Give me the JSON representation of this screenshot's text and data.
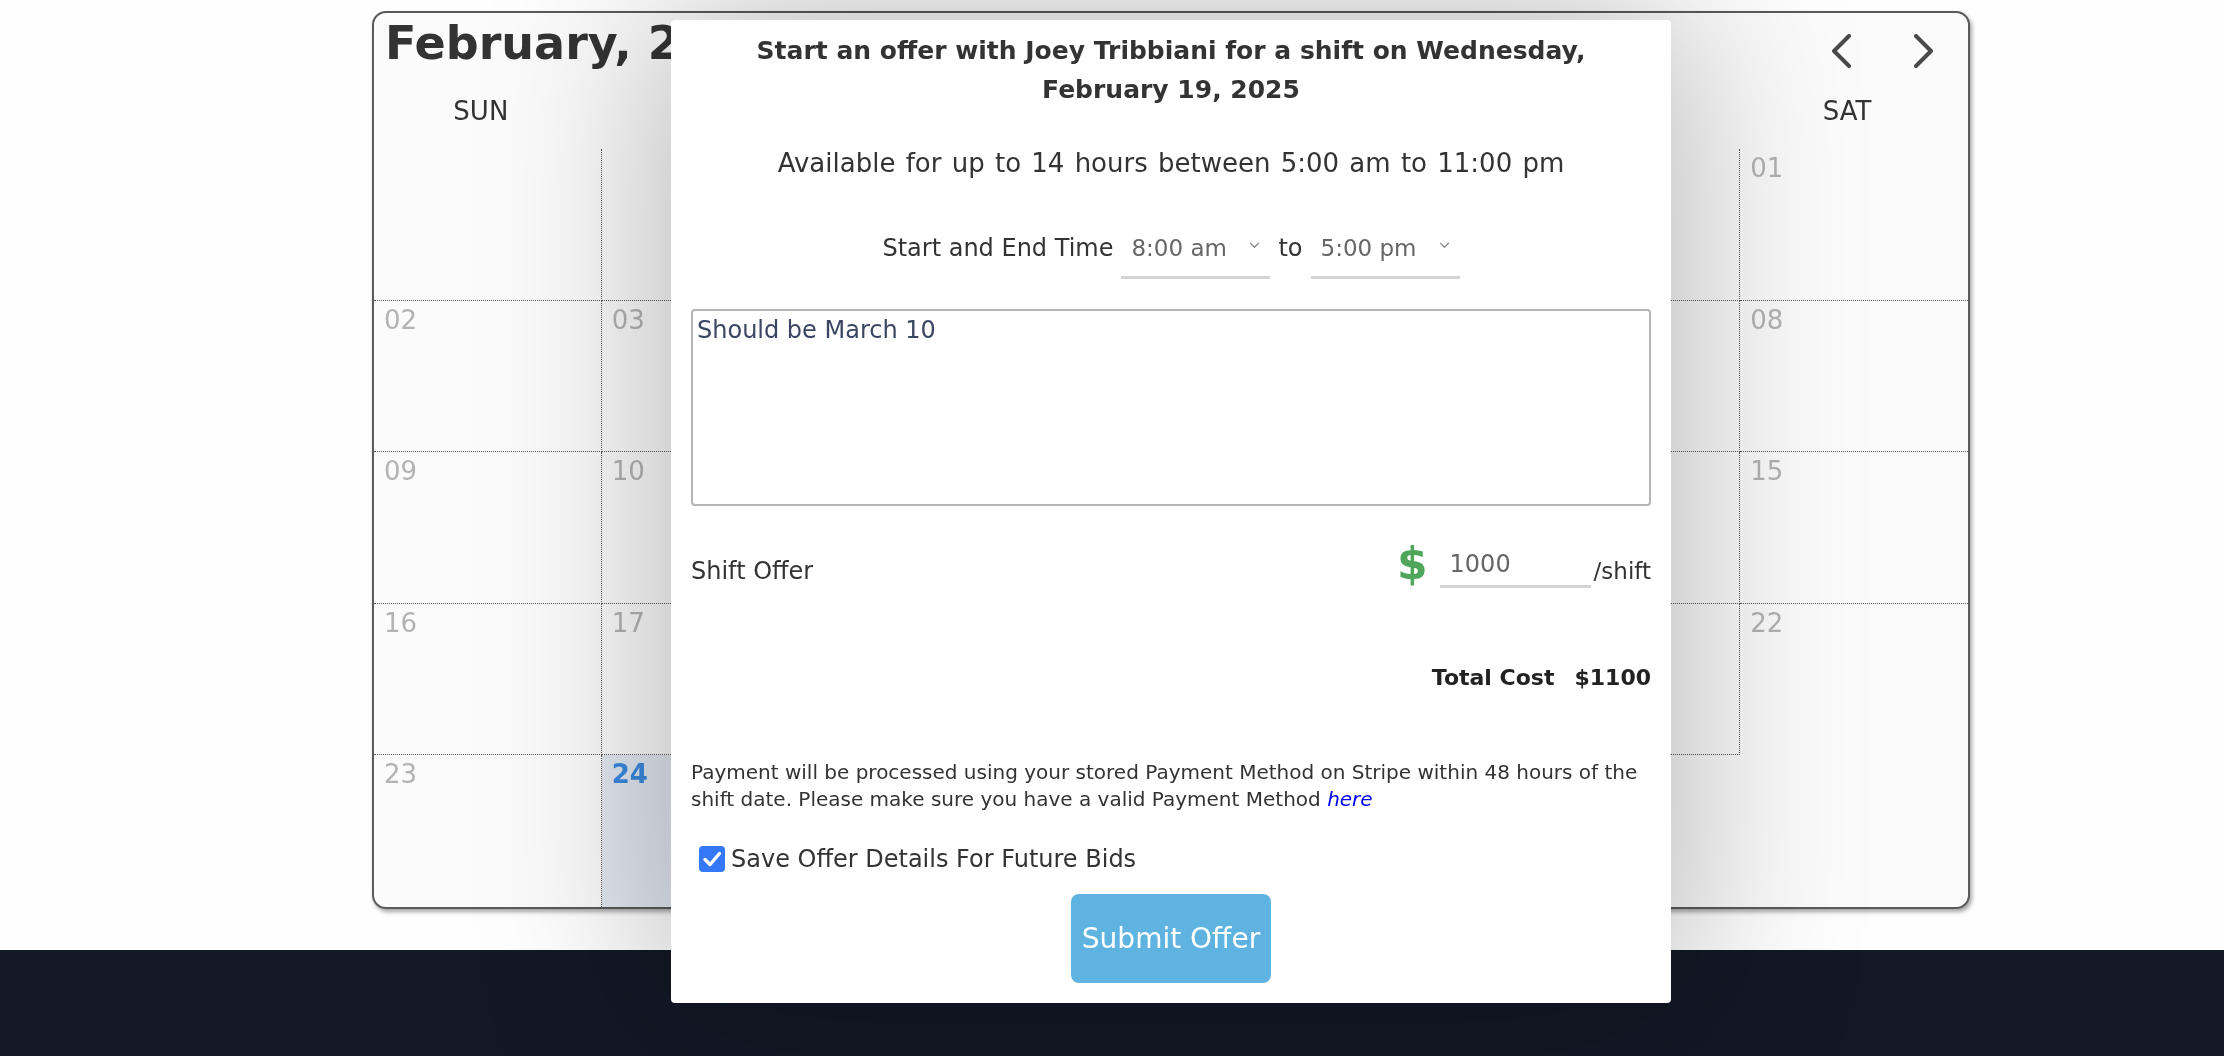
{
  "calendar": {
    "title": "February, 2",
    "weekdays": {
      "sun": "SUN",
      "sat": "SAT"
    },
    "weeks": [
      {
        "sat": {
          "day": "01",
          "today": false
        }
      },
      {
        "sun": {
          "day": "02",
          "today": false
        },
        "mon": {
          "day": "03",
          "today": false
        },
        "sat": {
          "day": "08",
          "today": false
        }
      },
      {
        "sun": {
          "day": "09",
          "today": false
        },
        "mon": {
          "day": "10",
          "today": false
        },
        "sat": {
          "day": "15",
          "today": false
        }
      },
      {
        "sun": {
          "day": "16",
          "today": false
        },
        "mon": {
          "day": "17",
          "today": false
        },
        "sat": {
          "day": "22",
          "today": false
        }
      },
      {
        "sun": {
          "day": "23",
          "today": false
        },
        "mon": {
          "day": "24",
          "today": true
        }
      }
    ]
  },
  "offer_dialog": {
    "title": "Start an offer with Joey Tribbiani for a shift on Wednesday, February 19, 2025",
    "availability": "Available for up to 14 hours between 5:00 am to 11:00 pm",
    "time_range": {
      "label": "Start and End Time",
      "start": "8:00 am",
      "separator": "to",
      "end": "5:00 pm"
    },
    "message": {
      "value": "Should be March 10"
    },
    "shift_offer": {
      "label": "Shift Offer",
      "currency": "$",
      "amount": "1000",
      "unit": "/shift"
    },
    "total": {
      "label": "Total Cost",
      "value": "$1100"
    },
    "payment_note": {
      "text": "Payment will be processed using your stored Payment Method on Stripe within 48 hours of the shift date. Please make sure you have a valid Payment Method",
      "link": "here"
    },
    "save_details": {
      "label": "Save Offer Details For Future Bids",
      "checked": true
    },
    "submit_button": "Submit Offer"
  }
}
